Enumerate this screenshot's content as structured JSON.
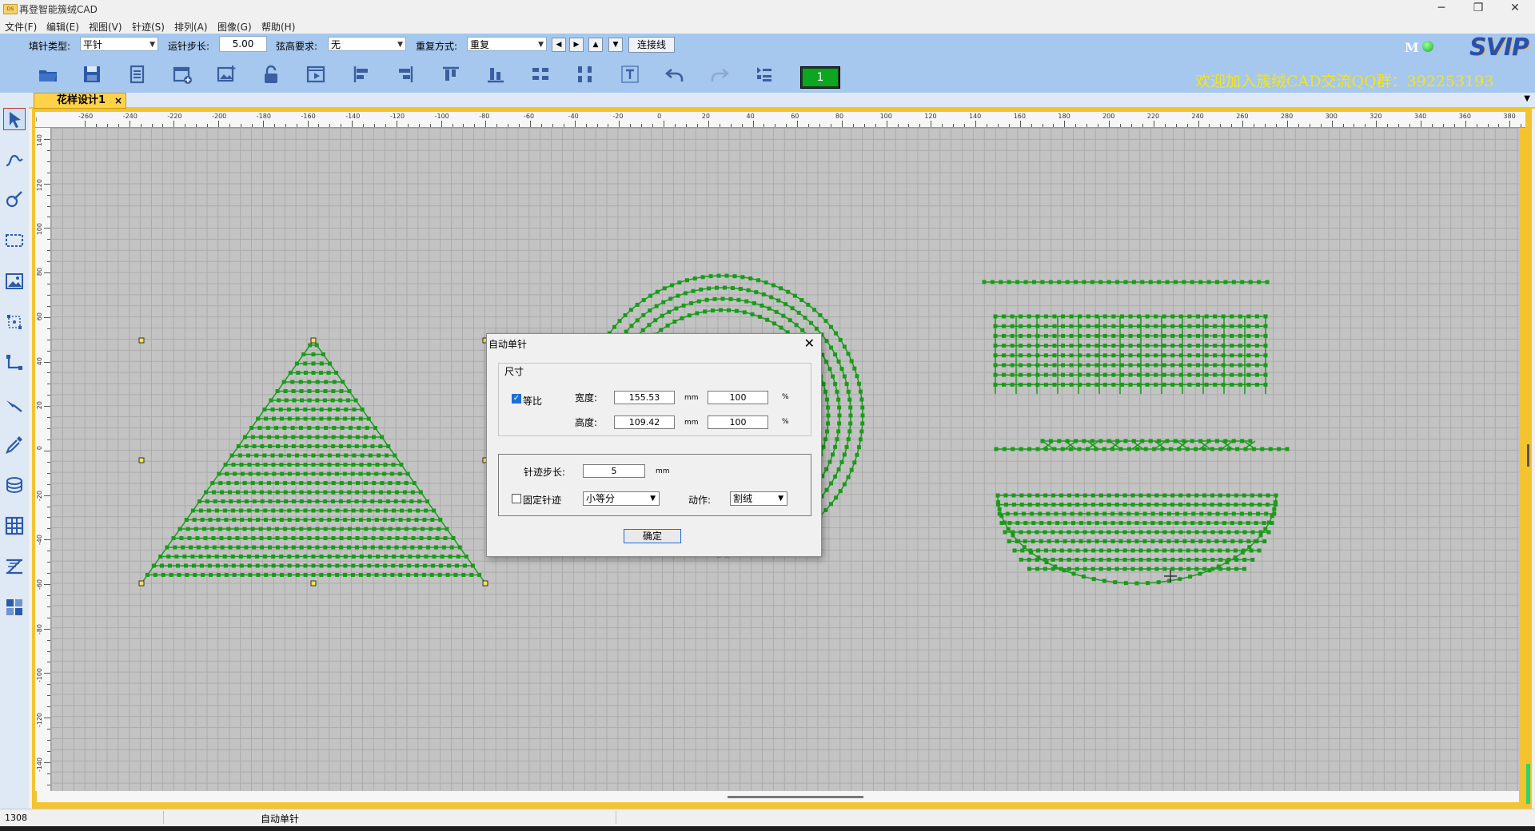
{
  "window": {
    "title": "再登智能簇绒CAD",
    "app_icon": "app-logo"
  },
  "menu": [
    "文件(F)",
    "编辑(E)",
    "视图(V)",
    "针迹(S)",
    "排列(A)",
    "图像(G)",
    "帮助(H)"
  ],
  "options": {
    "fill_type_label": "填针类型:",
    "fill_type_value": "平针",
    "run_step_label": "运针步长:",
    "run_step_value": "5.00",
    "chord_label": "弦高要求:",
    "chord_value": "无",
    "repeat_label": "重复方式:",
    "repeat_value": "重复",
    "connect_button": "连接线"
  },
  "toolbar": {
    "counter": "1",
    "welcome": "欢迎加入簇绒CAD交流QQ群：392253193",
    "m_label": "M",
    "vip_badge": "SVIP"
  },
  "tabs": {
    "doc_tab": "花样设计1",
    "close": "×"
  },
  "ruler": {
    "unit": "mm",
    "top_ticks": [
      "-260",
      "-240",
      "-220",
      "-200",
      "-180",
      "-160",
      "-140",
      "-120",
      "-100",
      "-80",
      "-60",
      "-40",
      "-20",
      "0",
      "20",
      "40",
      "60",
      "80",
      "100",
      "120",
      "140",
      "160",
      "180",
      "200",
      "220",
      "240",
      "260",
      "280",
      "300",
      "320",
      "340",
      "360",
      "380"
    ],
    "left_ticks": [
      "140",
      "120",
      "100",
      "80",
      "60",
      "40",
      "20",
      "0",
      "-20",
      "-40",
      "-60",
      "-80",
      "-100",
      "-120",
      "-140"
    ]
  },
  "dialog": {
    "title": "自动单针",
    "size_group": "尺寸",
    "proportional_label": "等比",
    "proportional_checked": true,
    "width_label": "宽度:",
    "width_value": "155.53",
    "width_unit": "mm",
    "width_percent": "100",
    "percent_sign": "%",
    "height_label": "高度:",
    "height_value": "109.42",
    "height_unit": "mm",
    "height_percent": "100",
    "step_label": "针迹步长:",
    "step_value": "5",
    "step_unit": "mm",
    "fixed_label": "固定针迹",
    "fixed_checked": false,
    "mode_value": "小等分",
    "action_label": "动作:",
    "action_value": "割绒",
    "ok_button": "确定",
    "close": "✕"
  },
  "status": {
    "coord": "1308",
    "message": "自动单针"
  },
  "colors": {
    "stitch": "#1a9b1a",
    "grid_bg": "#c3c3c3",
    "accent": "#f4c430",
    "toolbar_bg": "#a6c7ee"
  }
}
